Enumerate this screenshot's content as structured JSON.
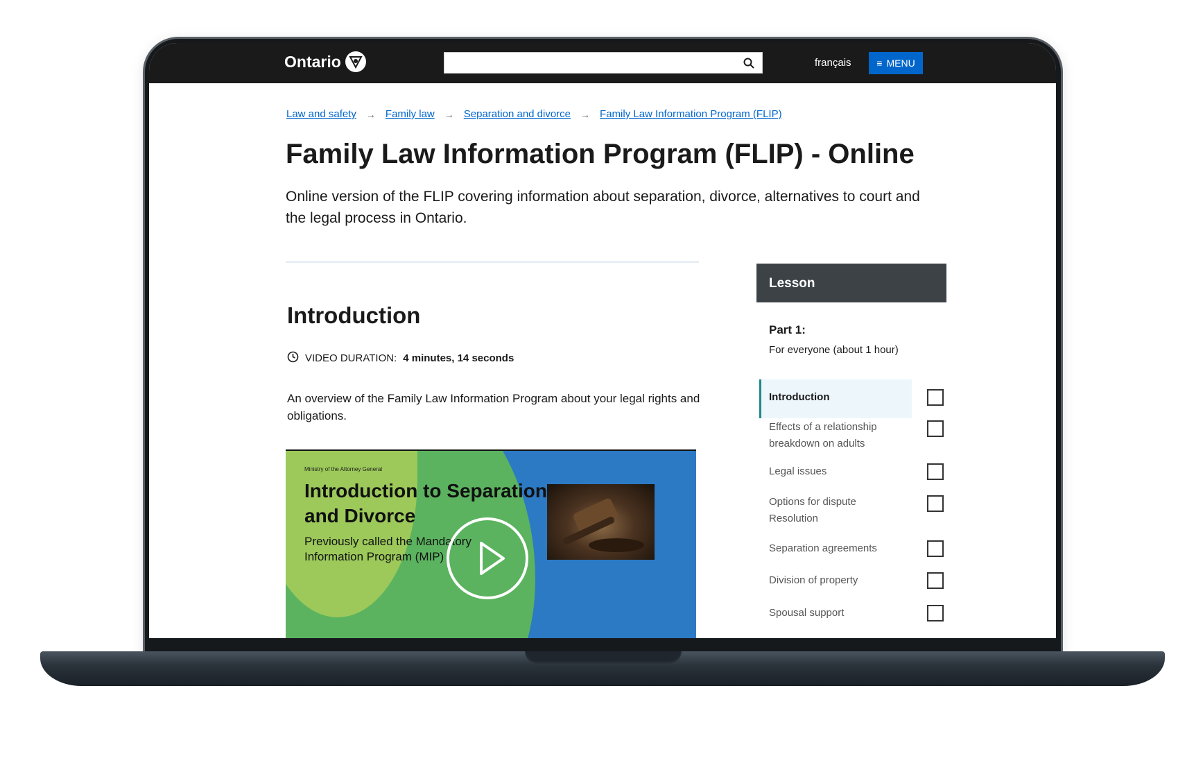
{
  "header": {
    "logo_text": "Ontario",
    "search_placeholder": "",
    "language_link": "français",
    "menu_label": "MENU"
  },
  "breadcrumb": [
    "Law and safety",
    "Family law",
    "Separation and divorce",
    "Family Law Information Program (FLIP)"
  ],
  "page": {
    "title": "Family Law Information Program (FLIP) - Online",
    "lead": "Online version of the FLIP covering information about separation, divorce, alternatives to court and the legal process in Ontario."
  },
  "section": {
    "title": "Introduction",
    "duration_label": "VIDEO DURATION:",
    "duration_value": "4 minutes, 14 seconds",
    "description": "An overview of the Family Law Information Program about your legal rights and obligations."
  },
  "video": {
    "ministry": "Ministry of the Attorney General",
    "heading": "Introduction to Separation and Divorce",
    "subheading": "Previously called the Mandatory Information Program (MIP)"
  },
  "sidebar": {
    "header": "Lesson",
    "part_title": "Part 1:",
    "part_subtitle": "For everyone (about 1 hour)",
    "items": [
      {
        "label": "Introduction",
        "active": true
      },
      {
        "label": "Effects of a relationship breakdown on adults",
        "active": false
      },
      {
        "label": "Legal issues",
        "active": false
      },
      {
        "label": "Options for dispute Resolution",
        "active": false
      },
      {
        "label": "Separation agreements",
        "active": false
      },
      {
        "label": "Division of property",
        "active": false
      },
      {
        "label": "Spousal support",
        "active": false
      }
    ]
  },
  "colors": {
    "header_bg": "#1a1a1a",
    "link": "#0066cc",
    "menu_button": "#0066cc",
    "lesson_header": "#3d4246",
    "active_accent": "#1d8a8a"
  }
}
